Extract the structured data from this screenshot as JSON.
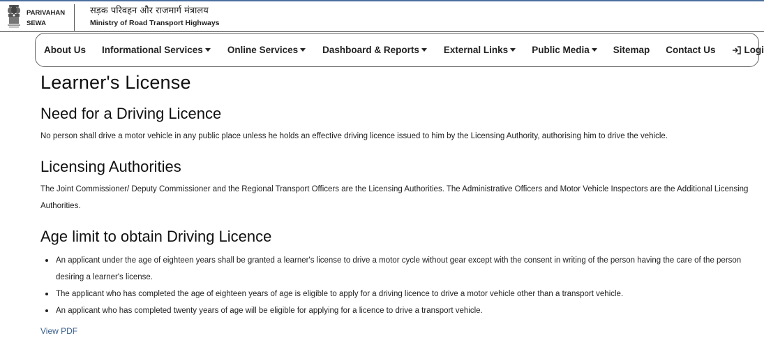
{
  "brand": {
    "name_line1": "PARIVAHAN",
    "name_line2": "SEWA",
    "ministry_hindi": "सड़क परिवहन और राजमार्ग मंत्रालय",
    "ministry_english": "Ministry of Road Transport Highways",
    "emblem_icon": "national-emblem-icon"
  },
  "nav": {
    "items": [
      {
        "label": "About  Us",
        "dropdown": false
      },
      {
        "label": "Informational  Services",
        "dropdown": true
      },
      {
        "label": "Online  Services",
        "dropdown": true
      },
      {
        "label": "Dashboard  &  Reports",
        "dropdown": true
      },
      {
        "label": "External  Links",
        "dropdown": true
      },
      {
        "label": "Public  Media",
        "dropdown": true
      },
      {
        "label": "Sitemap",
        "dropdown": false
      },
      {
        "label": "Contact  Us",
        "dropdown": false
      }
    ],
    "login_label": "Login",
    "login_icon": "login-icon"
  },
  "page": {
    "title": "Learner's License",
    "sections": [
      {
        "title": "Need for a Driving Licence",
        "text": "No person shall drive a motor vehicle in any public place unless he holds an effective driving licence issued to him by the Licensing Authority, authorising him to drive the vehicle."
      },
      {
        "title": "Licensing Authorities",
        "text": "The Joint Commissioner/ Deputy Commissioner and the Regional Transport Officers are the Licensing Authorities. The Administrative Officers and Motor Vehicle Inspectors are the Additional Licensing Authorities."
      },
      {
        "title": "Age limit to obtain Driving Licence",
        "bullets": [
          "An applicant under the age of eighteen years shall be granted a learner's license to drive a motor cycle without gear except with the consent in writing of the person having the care of the person desiring a learner's license.",
          "The applicant who has completed the age of eighteen years of age is eligible to apply for a driving licence to drive a motor vehicle other than a transport vehicle.",
          "An applicant who has completed twenty years of age will be eligible for applying for a licence to drive a transport vehicle."
        ]
      }
    ],
    "view_pdf_label": "View PDF"
  },
  "colors": {
    "top_line": "#4a6f9e",
    "link": "#3a5f8a"
  }
}
